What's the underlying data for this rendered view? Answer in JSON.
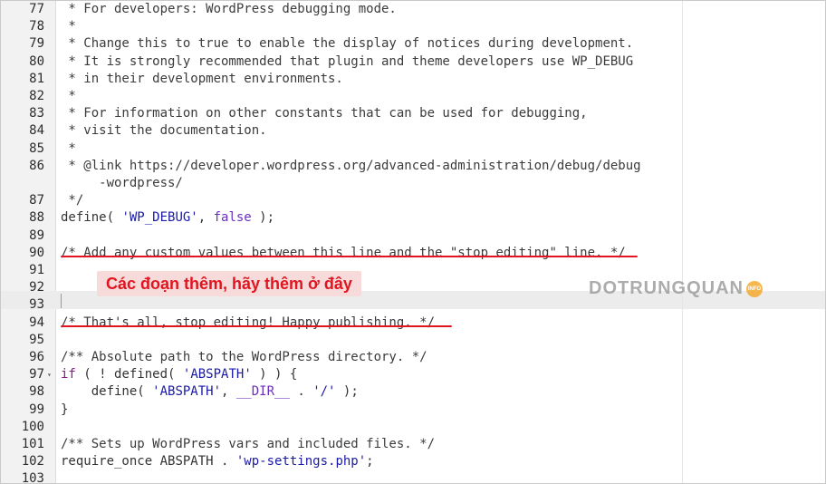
{
  "editor": {
    "lines": [
      {
        "num": "77",
        "tokens": [
          {
            "t": " * For developers: WordPress debugging mode.",
            "c": "cmt"
          }
        ]
      },
      {
        "num": "78",
        "tokens": [
          {
            "t": " *",
            "c": "cmt"
          }
        ]
      },
      {
        "num": "79",
        "tokens": [
          {
            "t": " * Change this to true to enable the display of notices during development.",
            "c": "cmt"
          }
        ]
      },
      {
        "num": "80",
        "tokens": [
          {
            "t": " * It is strongly recommended that plugin and theme developers use WP_DEBUG",
            "c": "cmt"
          }
        ]
      },
      {
        "num": "81",
        "tokens": [
          {
            "t": " * in their development environments.",
            "c": "cmt"
          }
        ]
      },
      {
        "num": "82",
        "tokens": [
          {
            "t": " *",
            "c": "cmt"
          }
        ]
      },
      {
        "num": "83",
        "tokens": [
          {
            "t": " * For information on other constants that can be used for debugging,",
            "c": "cmt"
          }
        ]
      },
      {
        "num": "84",
        "tokens": [
          {
            "t": " * visit the documentation.",
            "c": "cmt"
          }
        ]
      },
      {
        "num": "85",
        "tokens": [
          {
            "t": " *",
            "c": "cmt"
          }
        ]
      },
      {
        "num": "86",
        "tokens": [
          {
            "t": " * @link https://developer.wordpress.org/advanced-administration/debug/debug",
            "c": "cmt"
          }
        ]
      },
      {
        "num": "",
        "tokens": [
          {
            "t": "     -wordpress/",
            "c": "cmt"
          }
        ]
      },
      {
        "num": "87",
        "tokens": [
          {
            "t": " */",
            "c": "cmt"
          }
        ]
      },
      {
        "num": "88",
        "tokens": [
          {
            "t": "define",
            "c": "fn"
          },
          {
            "t": "( ",
            "c": "pl"
          },
          {
            "t": "'WP_DEBUG'",
            "c": "str"
          },
          {
            "t": ", ",
            "c": "pl"
          },
          {
            "t": "false",
            "c": "cst"
          },
          {
            "t": " );",
            "c": "pl"
          }
        ]
      },
      {
        "num": "89",
        "tokens": []
      },
      {
        "num": "90",
        "tokens": [
          {
            "t": "/* Add any custom values between this line and the \"stop editing\" line. */",
            "c": "cmt"
          }
        ]
      },
      {
        "num": "91",
        "tokens": []
      },
      {
        "num": "92",
        "tokens": []
      },
      {
        "num": "93",
        "tokens": []
      },
      {
        "num": "94",
        "tokens": [
          {
            "t": "/* That's all, stop editing! Happy publishing. */",
            "c": "cmt"
          }
        ]
      },
      {
        "num": "95",
        "tokens": []
      },
      {
        "num": "96",
        "tokens": [
          {
            "t": "/** Absolute path to the WordPress directory. */",
            "c": "cmt"
          }
        ]
      },
      {
        "num": "97",
        "fold": "▾",
        "tokens": [
          {
            "t": "if",
            "c": "kw"
          },
          {
            "t": " ( ! ",
            "c": "pl"
          },
          {
            "t": "defined",
            "c": "fn"
          },
          {
            "t": "( ",
            "c": "pl"
          },
          {
            "t": "'ABSPATH'",
            "c": "str"
          },
          {
            "t": " ) ) {",
            "c": "pl"
          }
        ]
      },
      {
        "num": "98",
        "tokens": [
          {
            "t": "    define",
            "c": "fn"
          },
          {
            "t": "( ",
            "c": "pl"
          },
          {
            "t": "'ABSPATH'",
            "c": "str"
          },
          {
            "t": ", ",
            "c": "pl"
          },
          {
            "t": "__DIR__",
            "c": "cst"
          },
          {
            "t": " . ",
            "c": "pl"
          },
          {
            "t": "'/'",
            "c": "str"
          },
          {
            "t": " );",
            "c": "pl"
          }
        ]
      },
      {
        "num": "99",
        "tokens": [
          {
            "t": "}",
            "c": "pl"
          }
        ]
      },
      {
        "num": "100",
        "tokens": []
      },
      {
        "num": "101",
        "tokens": [
          {
            "t": "/** Sets up WordPress vars and included files. */",
            "c": "cmt"
          }
        ]
      },
      {
        "num": "102",
        "tokens": [
          {
            "t": "require_once",
            "c": "fn"
          },
          {
            "t": " ABSPATH . ",
            "c": "pl"
          },
          {
            "t": "'wp-settings.php'",
            "c": "str"
          },
          {
            "t": ";",
            "c": "pl"
          }
        ]
      },
      {
        "num": "103",
        "tokens": []
      }
    ]
  },
  "annotation": {
    "callout_text": "Các đoạn thêm, hãy thêm ở đây"
  },
  "watermark": {
    "text": "DOTRUNGQUAN",
    "badge": "INFO"
  },
  "colors": {
    "annotation_red": "#e0151f",
    "callout_bg": "#f7dada",
    "string": "#1a1aa6",
    "keyword": "#8a1a8f",
    "constant": "#6b2fbe"
  }
}
